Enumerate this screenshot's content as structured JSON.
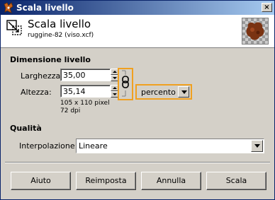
{
  "window": {
    "title": "Scala livello",
    "close_glyph": "×"
  },
  "header": {
    "title": "Scala livello",
    "subtitle": "ruggine-82 (viso.xcf)",
    "thumbnail_icon": "layer-thumbnail-icon"
  },
  "layer_size": {
    "section_label": "Dimensione livello",
    "width_label": "Larghezza:",
    "width_value": "35,00",
    "height_label": "Altezza:",
    "height_value": "35,14",
    "pixel_info": "105 x 110 pixel",
    "dpi_info": "72 dpi",
    "unit_value": "percento",
    "chain_icon": "chain-link-icon"
  },
  "quality": {
    "section_label": "Qualità",
    "interpolation_label": "Interpolazione:",
    "interpolation_value": "Lineare"
  },
  "buttons": {
    "help": "Aiuto",
    "reset": "Reimposta",
    "cancel": "Annulla",
    "scale": "Scala"
  },
  "colors": {
    "highlight": "#f0a020",
    "titlebar": "#0a246a"
  }
}
